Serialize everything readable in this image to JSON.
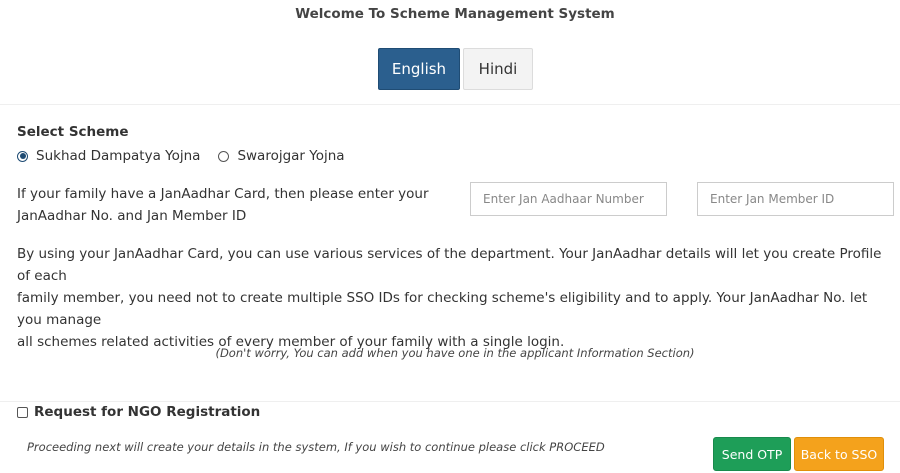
{
  "header": {
    "title": "Welcome To Scheme Management System"
  },
  "language": {
    "options": [
      "English",
      "Hindi"
    ],
    "selected": "English"
  },
  "scheme": {
    "label": "Select Scheme",
    "options": [
      "Sukhad Dampatya Yojna",
      "Swarojgar Yojna"
    ],
    "selected": "Sukhad Dampatya Yojna"
  },
  "janaadhar": {
    "intro_line1": "If your family have a JanAadhar Card, then please enter your",
    "intro_line2": "JanAadhar No. and Jan Member ID",
    "aadhaar_placeholder": "Enter Jan Aadhaar Number",
    "aadhaar_value": "",
    "member_placeholder": "Enter Jan Member ID",
    "member_value": "",
    "description_line1": "By using your JanAadhar Card, you can use various services of the department. Your JanAadhar details will let you create Profile of each",
    "description_line2": "family member, you need not to create multiple SSO IDs for checking scheme's eligibility and to apply. Your JanAadhar No. let you manage",
    "description_line3": "all schemes related activities of every member of your family with a single login.",
    "note": "(Don't worry, You can add when you have one in the applicant Information Section)"
  },
  "ngo": {
    "label": "Request for NGO Registration",
    "checked": false
  },
  "footer": {
    "proceed_note": "Proceeding next will create your details in the system, If you wish to continue please click PROCEED",
    "send_otp_label": "Send OTP",
    "back_label": "Back to SSO"
  },
  "colors": {
    "primary": "#2b5f8e",
    "success": "#1e9e58",
    "warning": "#f4a21c"
  }
}
